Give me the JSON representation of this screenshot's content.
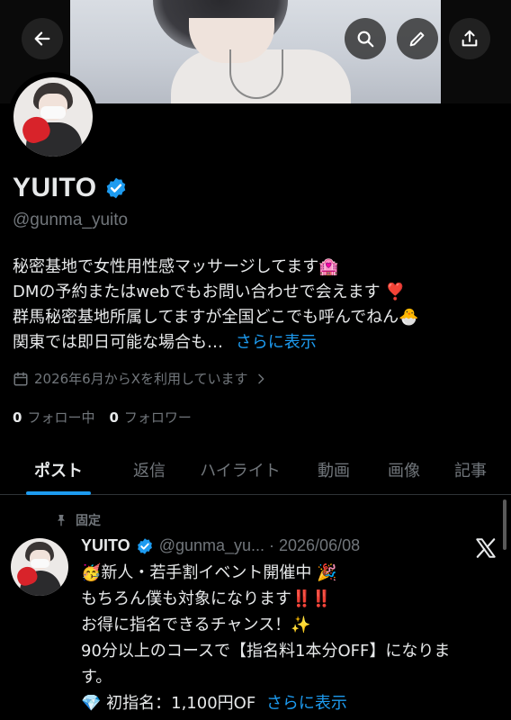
{
  "header": {
    "back_icon": "arrow-left-icon",
    "search_icon": "search-icon",
    "edit_icon": "pencil-icon",
    "share_icon": "share-icon"
  },
  "profile": {
    "name": "YUITO",
    "handle": "@gunma_yuito",
    "bio_lines": [
      "秘密基地で女性用性感マッサージしてます🏩",
      "DMの予約またはwebでもお問い合わせで会えます ❣️",
      "群馬秘密基地所属してますが全国どこでも呼んでねん🐣",
      "関東では即日可能な場合も…"
    ],
    "bio_more": "さらに表示",
    "joined": "2026年6月からXを利用しています",
    "following_count": "0",
    "following_label": "フォロー中",
    "followers_count": "0",
    "followers_label": "フォロワー"
  },
  "tabs": [
    {
      "label": "ポスト",
      "active": true
    },
    {
      "label": "返信",
      "active": false
    },
    {
      "label": "ハイライト",
      "active": false
    },
    {
      "label": "動画",
      "active": false
    },
    {
      "label": "画像",
      "active": false
    },
    {
      "label": "記事",
      "active": false
    }
  ],
  "post": {
    "pinned_label": "固定",
    "author_name": "YUITO",
    "author_handle_date": "@gunma_yu... · 2026/06/08",
    "lines": [
      "🥳新人・若手割イベント開催中 🎉",
      "もちろん僕も対象になります‼️‼️",
      "お得に指名できるチャンス！✨",
      "90分以上のコースで【指名料1本分OFF】になりま",
      "す。",
      "💎 初指名：1,100円OF"
    ],
    "more": "さらに表示"
  },
  "colors": {
    "background": "#000000",
    "text": "#e7e9ea",
    "muted": "#71767b",
    "accent": "#1d9bf0"
  }
}
